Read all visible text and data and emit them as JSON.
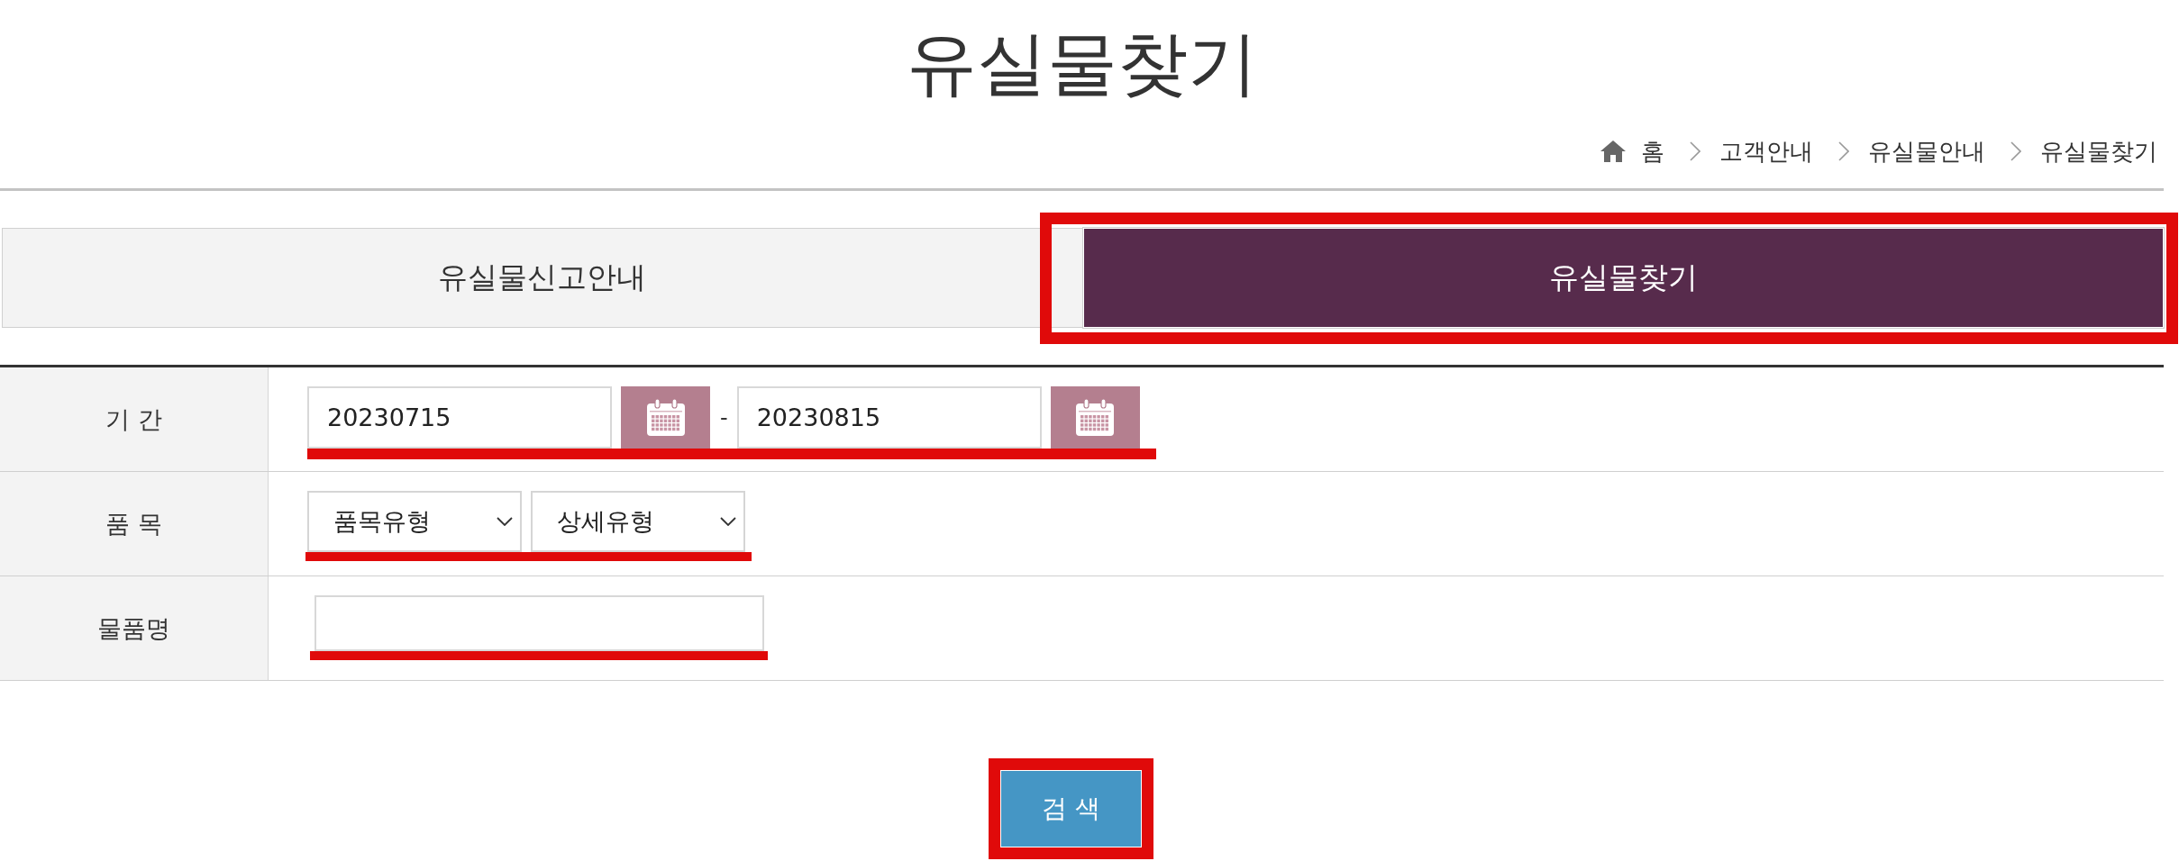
{
  "page_title": "유실물찾기",
  "breadcrumb": [
    {
      "kind": "home",
      "label": "홈"
    },
    {
      "kind": "page",
      "label": "고객안내"
    },
    {
      "kind": "page",
      "label": "유실물안내"
    },
    {
      "kind": "page",
      "label": "유실물찾기"
    }
  ],
  "tabs": [
    {
      "label": "유실물신고안내",
      "selected": false,
      "highlighted": false
    },
    {
      "label": "유실물찾기",
      "selected": true,
      "highlighted": true
    }
  ],
  "search_form": {
    "rows": [
      {
        "kind": "date_range",
        "label": "기 간",
        "highlighted": true,
        "start_date": "20230715",
        "separator": "-",
        "end_date": "20230815"
      },
      {
        "kind": "dropdowns",
        "label": "품 목",
        "highlighted": true,
        "dropdowns": [
          {
            "value": "품목유형"
          },
          {
            "value": "상세유형"
          }
        ]
      },
      {
        "kind": "text",
        "label": "물품명",
        "highlighted": true
      }
    ]
  },
  "search_button": {
    "label": "검 색",
    "highlighted": true
  }
}
